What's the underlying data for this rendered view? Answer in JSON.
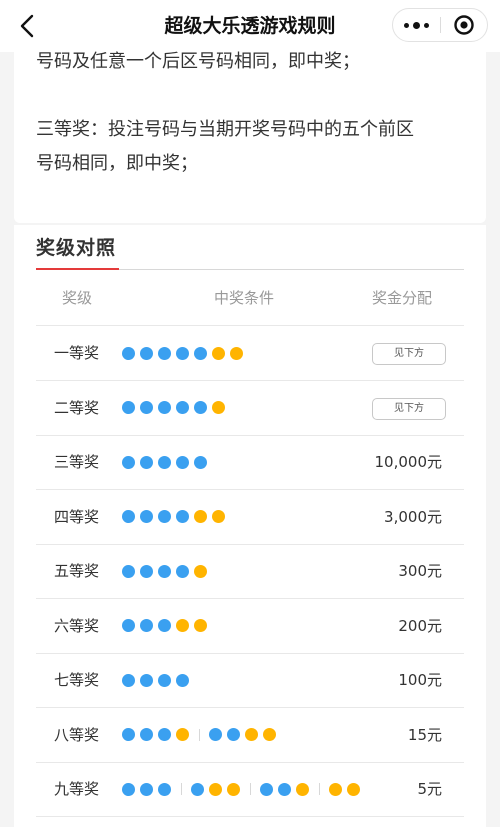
{
  "nav": {
    "title": "超级大乐透游戏规则",
    "back_icon": "chevron-left-icon",
    "more_icon": "more-dots-icon",
    "close_icon": "record-close-icon"
  },
  "rules": {
    "second_prize_tail": "号码及任意一个后区号码相同，即中奖；",
    "third_prize_line1": "三等奖：投注号码与当期开奖号码中的五个前区",
    "third_prize_line2": "号码相同，即中奖；"
  },
  "section": {
    "title": "奖级对照",
    "accent_color": "#e43a3a"
  },
  "table": {
    "headers": [
      "奖级",
      "中奖条件",
      "奖金分配"
    ],
    "ball_colors": {
      "front": "#3aa0f0",
      "back": "#ffb400"
    },
    "rows": [
      {
        "name": "一等奖",
        "groups": [
          [
            5,
            2
          ]
        ],
        "prize": "见下方",
        "prize_is_button": true
      },
      {
        "name": "二等奖",
        "groups": [
          [
            5,
            1
          ]
        ],
        "prize": "见下方",
        "prize_is_button": true
      },
      {
        "name": "三等奖",
        "groups": [
          [
            5,
            0
          ]
        ],
        "prize": "10,000元",
        "prize_is_button": false
      },
      {
        "name": "四等奖",
        "groups": [
          [
            4,
            2
          ]
        ],
        "prize": "3,000元",
        "prize_is_button": false
      },
      {
        "name": "五等奖",
        "groups": [
          [
            4,
            1
          ]
        ],
        "prize": "300元",
        "prize_is_button": false
      },
      {
        "name": "六等奖",
        "groups": [
          [
            3,
            2
          ]
        ],
        "prize": "200元",
        "prize_is_button": false
      },
      {
        "name": "七等奖",
        "groups": [
          [
            4,
            0
          ]
        ],
        "prize": "100元",
        "prize_is_button": false
      },
      {
        "name": "八等奖",
        "groups": [
          [
            3,
            1
          ],
          [
            2,
            2
          ]
        ],
        "prize": "15元",
        "prize_is_button": false
      },
      {
        "name": "九等奖",
        "groups": [
          [
            3,
            0
          ],
          [
            1,
            2
          ],
          [
            2,
            1
          ],
          [
            0,
            2
          ]
        ],
        "prize": "5元",
        "prize_is_button": false
      }
    ]
  }
}
